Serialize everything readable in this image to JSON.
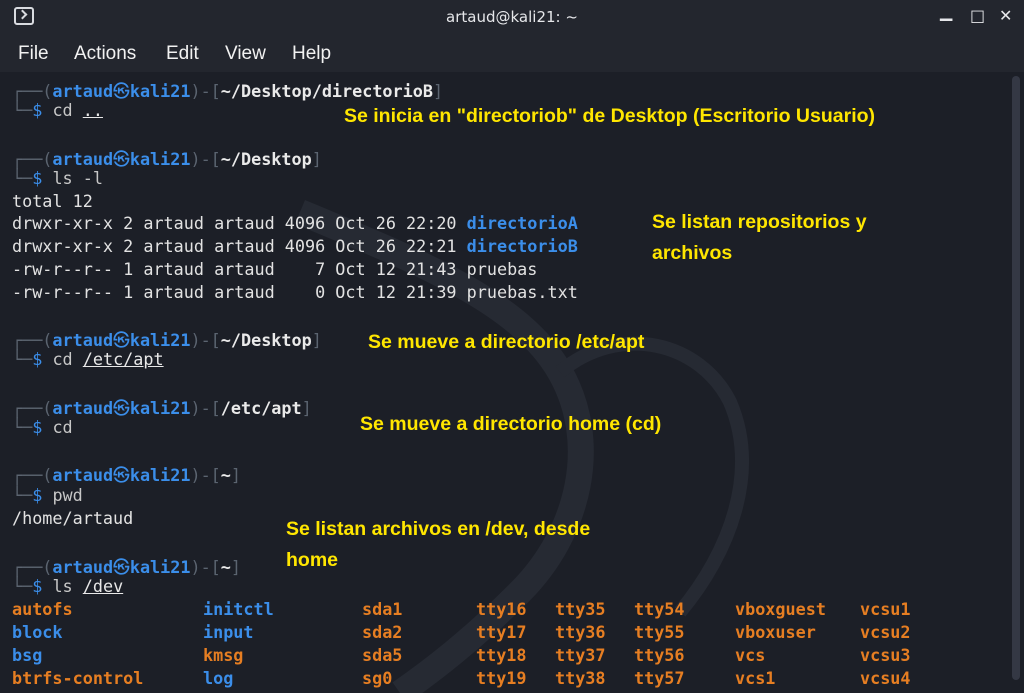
{
  "window": {
    "title": "artaud@kali21: ~",
    "min": "▁",
    "max": "□",
    "close": "✕"
  },
  "menu": [
    "File",
    "Actions",
    "Edit",
    "View",
    "Help"
  ],
  "prompt": {
    "user": "artaud",
    "host": "kali21",
    "at": "㉿",
    "dollar": "$"
  },
  "blocks": [
    {
      "path": "~/Desktop/directorioB",
      "cmd": "cd",
      "arg": ".."
    },
    {
      "path": "~/Desktop",
      "cmd": "ls -l",
      "arg": ""
    },
    {
      "path": "~/Desktop",
      "cmd": "cd",
      "arg": "/etc/apt"
    },
    {
      "path": "/etc/apt",
      "cmd": "cd",
      "arg": ""
    },
    {
      "path": "~",
      "cmd": "pwd",
      "arg": ""
    },
    {
      "path": "~",
      "cmd": "ls",
      "arg": "/dev"
    }
  ],
  "ls_total": "total 12",
  "ls_rows": [
    {
      "meta": "drwxr-xr-x 2 artaud artaud 4096 Oct 26 22:20 ",
      "name": "directorioA",
      "type": "dir"
    },
    {
      "meta": "drwxr-xr-x 2 artaud artaud 4096 Oct 26 22:21 ",
      "name": "directorioB",
      "type": "dir"
    },
    {
      "meta": "-rw-r--r-- 1 artaud artaud    7 Oct 12 21:43 ",
      "name": "pruebas",
      "type": "file"
    },
    {
      "meta": "-rw-r--r-- 1 artaud artaud    0 Oct 12 21:39 ",
      "name": "pruebas.txt",
      "type": "file"
    }
  ],
  "pwd_output": "/home/artaud",
  "dev_columns": [
    [
      "autofs",
      "block",
      "bsg",
      "btrfs-control"
    ],
    [
      "initctl",
      "input",
      "kmsg",
      "log"
    ],
    [
      "sda1",
      "sda2",
      "sda5",
      "sg0"
    ],
    [
      "tty16",
      "tty17",
      "tty18",
      "tty19"
    ],
    [
      "tty35",
      "tty36",
      "tty37",
      "tty38"
    ],
    [
      "tty54",
      "tty55",
      "tty56",
      "tty57"
    ],
    [
      "vboxguest",
      "vboxuser",
      "vcs",
      "vcs1"
    ],
    [
      "vcsu1",
      "vcsu2",
      "vcsu3",
      "vcsu4"
    ]
  ],
  "dev_blue": [
    "block",
    "bsg",
    "initctl",
    "input",
    "log"
  ],
  "annotations": [
    "Se inicia en \"directoriob\" de Desktop (Escritorio Usuario)",
    "Se listan repositorios y",
    "archivos",
    "Se mueve a directorio /etc/apt",
    "Se mueve a directorio home (cd)",
    "Se listan archivos en /dev, desde",
    "home"
  ]
}
